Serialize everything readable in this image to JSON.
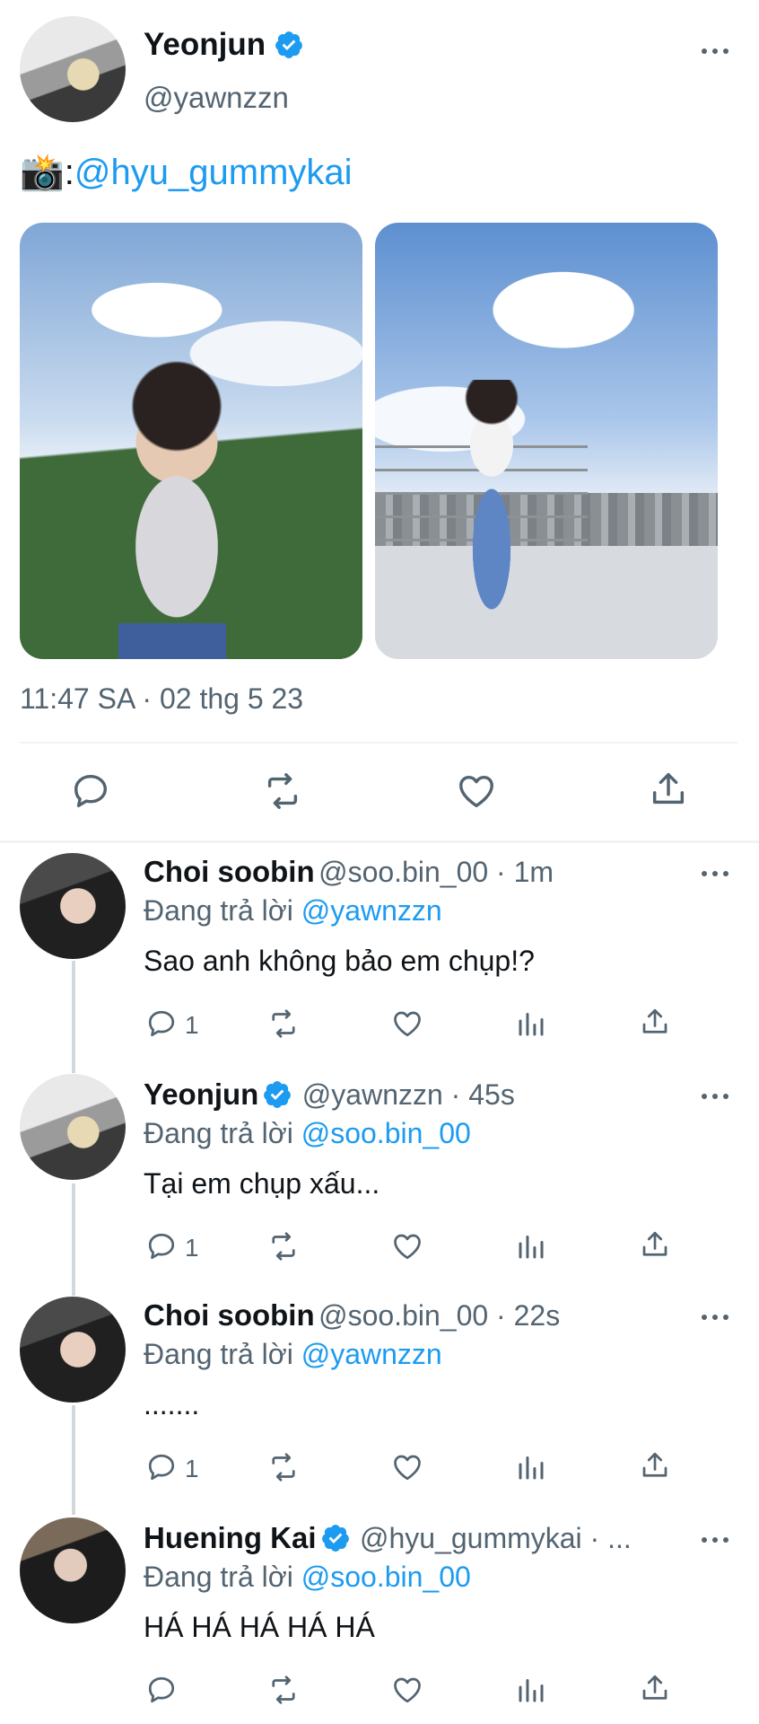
{
  "main_tweet": {
    "author_name": "Yeonjun",
    "author_handle": "@yawnzzn",
    "text_prefix": "📸:",
    "text_mention": "@hyu_gummykai",
    "timestamp": "11:47 SA · 02 thg 5 23"
  },
  "replies": [
    {
      "name": "Choi soobin",
      "verified": false,
      "meta": "@soo.bin_00 · 1m",
      "replying_prefix": "Đang trả lời ",
      "replying_to": "@yawnzzn",
      "text": "Sao anh không bảo em chụp!?",
      "reply_count": "1"
    },
    {
      "name": "Yeonjun",
      "verified": true,
      "meta": "@yawnzzn · 45s",
      "replying_prefix": "Đang trả lời ",
      "replying_to": "@soo.bin_00",
      "text": "Tại em chụp xấu...",
      "reply_count": "1"
    },
    {
      "name": "Choi soobin",
      "verified": false,
      "meta": "@soo.bin_00 · 22s",
      "replying_prefix": "Đang trả lời ",
      "replying_to": "@yawnzzn",
      "text": ".......",
      "reply_count": "1"
    },
    {
      "name": "Huening Kai",
      "verified": true,
      "meta": "@hyu_gummykai · ...",
      "replying_prefix": "Đang trả lời ",
      "replying_to": "@soo.bin_00",
      "text": "HÁ HÁ HÁ HÁ HÁ",
      "reply_count": ""
    }
  ],
  "colors": {
    "accent": "#1d9bf0",
    "text": "#0f1419",
    "secondary": "#536471",
    "divider": "#eff3f4"
  }
}
